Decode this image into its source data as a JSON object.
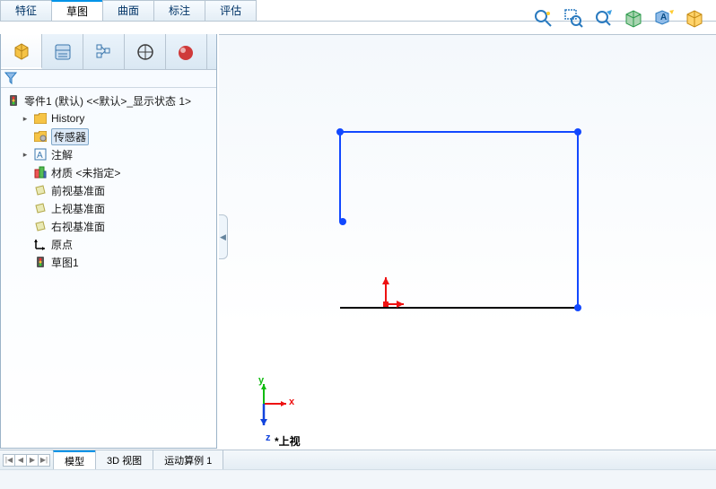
{
  "command_tabs": [
    "特征",
    "草图",
    "曲面",
    "标注",
    "评估"
  ],
  "command_tab_selected_index": 1,
  "tree_root": "零件1 (默认) <<默认>_显示状态 1>",
  "tree_items": [
    {
      "expander": "▸",
      "label": "History",
      "icon": "history"
    },
    {
      "expander": "",
      "label": "传感器",
      "icon": "sensor",
      "selected": true
    },
    {
      "expander": "▸",
      "label": "注解",
      "icon": "annotation"
    },
    {
      "expander": "",
      "label": "材质 <未指定>",
      "icon": "material"
    },
    {
      "expander": "",
      "label": "前视基准面",
      "icon": "plane"
    },
    {
      "expander": "",
      "label": "上视基准面",
      "icon": "plane"
    },
    {
      "expander": "",
      "label": "右视基准面",
      "icon": "plane"
    },
    {
      "expander": "",
      "label": "原点",
      "icon": "origin"
    },
    {
      "expander": "",
      "label": "草图1",
      "icon": "sketch"
    }
  ],
  "bottom_tabs": [
    "模型",
    "3D 视图",
    "运动算例 1"
  ],
  "bottom_tab_active_index": 0,
  "view_name": "*上视",
  "triad": {
    "x": "x",
    "y": "y",
    "z": "z"
  }
}
